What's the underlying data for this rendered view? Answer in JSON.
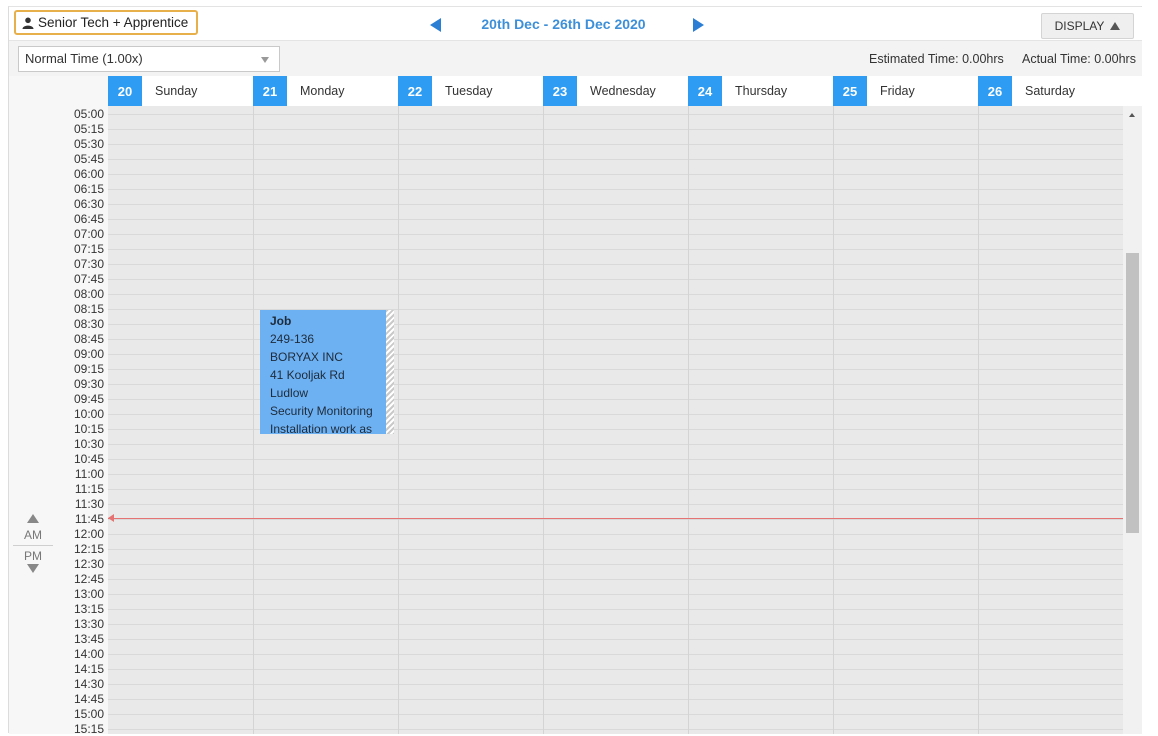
{
  "toolbar": {
    "resource_label": "Senior Tech + Apprentice",
    "date_range": "20th Dec - 26th Dec 2020",
    "display_label": "DISPLAY"
  },
  "subbar": {
    "time_mode": "Normal Time (1.00x)",
    "estimated_time": "Estimated Time: 0.00hrs",
    "actual_time": "Actual Time: 0.00hrs"
  },
  "days": [
    {
      "num": "20",
      "name": "Sunday"
    },
    {
      "num": "21",
      "name": "Monday"
    },
    {
      "num": "22",
      "name": "Tuesday"
    },
    {
      "num": "23",
      "name": "Wednesday"
    },
    {
      "num": "24",
      "name": "Thursday"
    },
    {
      "num": "25",
      "name": "Friday"
    },
    {
      "num": "26",
      "name": "Saturday"
    }
  ],
  "time_slots": [
    "05:00",
    "05:15",
    "05:30",
    "05:45",
    "06:00",
    "06:15",
    "06:30",
    "06:45",
    "07:00",
    "07:15",
    "07:30",
    "07:45",
    "08:00",
    "08:15",
    "08:30",
    "08:45",
    "09:00",
    "09:15",
    "09:30",
    "09:45",
    "10:00",
    "10:15",
    "10:30",
    "10:45",
    "11:00",
    "11:15",
    "11:30",
    "11:45",
    "12:00",
    "12:15",
    "12:30",
    "12:45",
    "13:00",
    "13:15",
    "13:30",
    "13:45",
    "14:00",
    "14:15",
    "14:30",
    "14:45",
    "15:00",
    "15:15"
  ],
  "ampm": {
    "am": "AM",
    "pm": "PM"
  },
  "job": {
    "title": "Job",
    "number": "249-136",
    "client": "BORYAX INC",
    "address": "41 Kooljak Rd",
    "suburb": "Ludlow",
    "service": "Security Monitoring",
    "description": "Installation work as"
  },
  "colors": {
    "accent": "#2d9cf2",
    "job_fill": "#6eb1f3",
    "now_line": "#e57373",
    "resource_border": "#e8b04a"
  }
}
